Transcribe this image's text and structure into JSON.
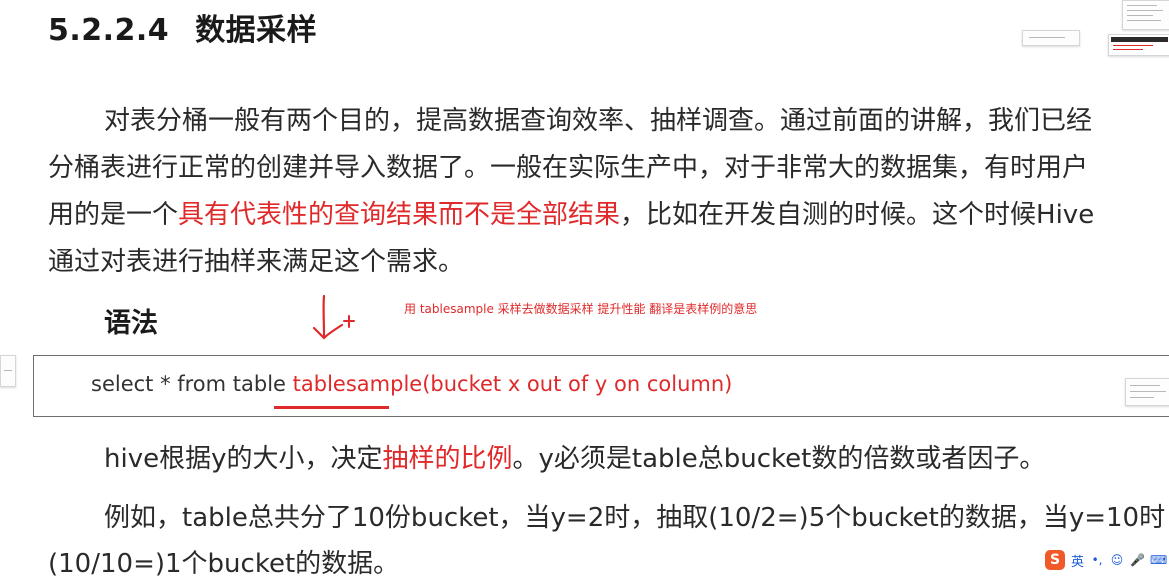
{
  "heading": {
    "number": "5.2.2.4",
    "title": "数据采样"
  },
  "intro": {
    "line1": "对表分桶一般有两个目的，提高数据查询效率、抽样调查。通过前面的讲解，我们已经",
    "line2": "分桶表进行正常的创建并导入数据了。一般在实际生产中，对于非常大的数据集，有时用户",
    "line3_before": "用的是一个",
    "line3_highlight": "具有代表性的查询结果而不是全部结果",
    "line3_after": "，比如在开发自测的时候。这个时候Hive",
    "line4": "通过对表进行抽样来满足这个需求。"
  },
  "syntax": {
    "title": "语法",
    "annotation": "用 tablesample 采样去做数据采样 提升性能 翻译是表样例的意思",
    "code_plain": "select * from table ",
    "code_highlight": "tablesample(bucket x out of y on column)"
  },
  "explanation": {
    "line1_before": "hive根据y的大小，决定",
    "line1_highlight": "抽样的比例",
    "line1_after": "。y必须是table总bucket数的倍数或者因子。",
    "line2": "例如，table总共分了10份bucket，当y=2时，抽取(10/2=)5个bucket的数据，当y=10时",
    "line3": "(10/10=)1个bucket的数据。"
  },
  "ime": {
    "logo": "S",
    "mode": "英",
    "punct": "•,",
    "emoji": "☺",
    "mic": "🎤",
    "keyboard": "⌨"
  },
  "colors": {
    "highlight": "#e0292a",
    "text": "#2a2a2a",
    "ime_blue": "#1c5bd8",
    "ime_logo": "#f05a28"
  }
}
